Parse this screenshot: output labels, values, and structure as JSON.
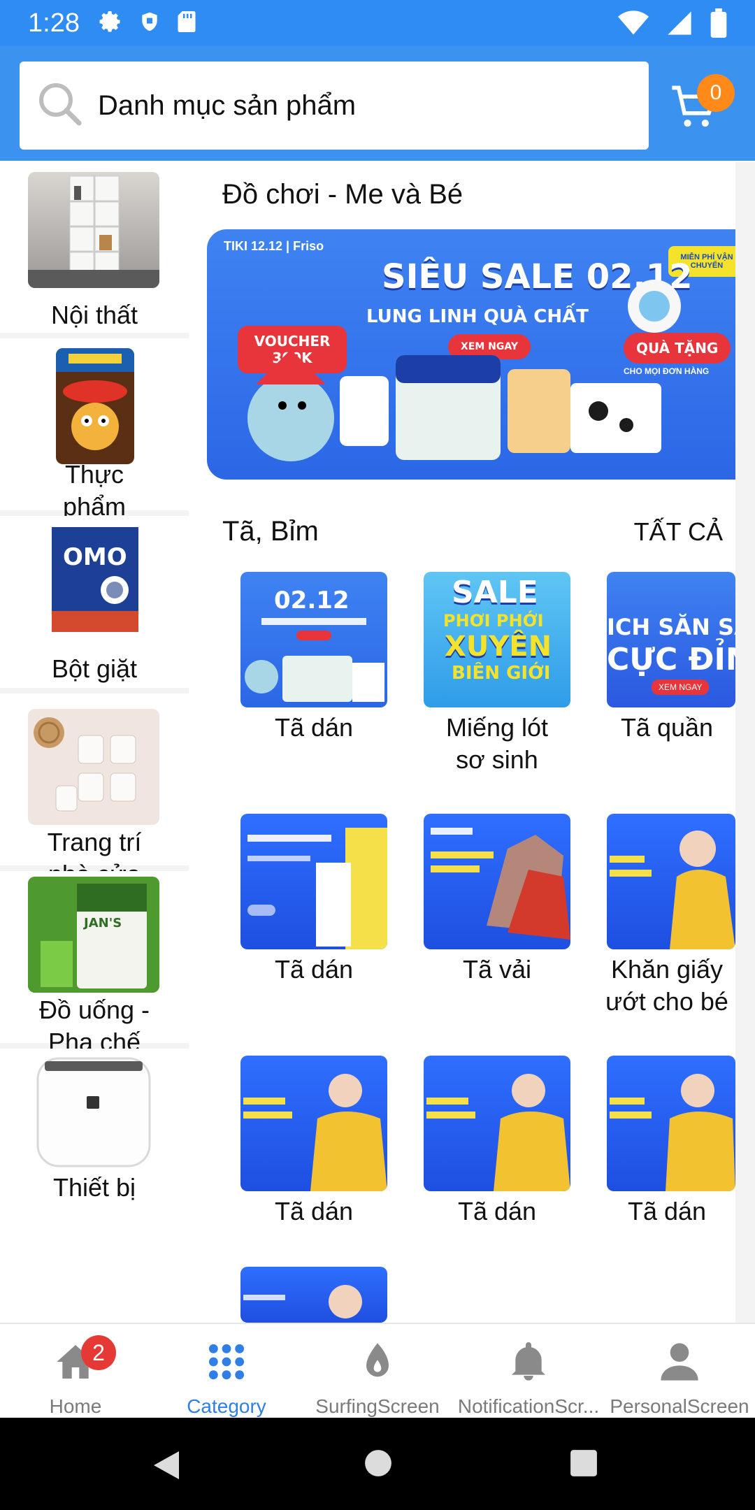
{
  "status_bar": {
    "time": "1:28"
  },
  "header": {
    "search_text": "Danh mục sản phẩm",
    "cart_count": "0"
  },
  "sidebar": {
    "items": [
      {
        "label_line1": "Nội thất",
        "label_line2": ""
      },
      {
        "label_line1": "Thực",
        "label_line2": "phẩm"
      },
      {
        "label_line1": "Bột giặt",
        "label_line2": ""
      },
      {
        "label_line1": "Trang trí",
        "label_line2": "nhà cửa"
      },
      {
        "label_line1": "Đồ uống -",
        "label_line2": "Pha chế"
      },
      {
        "label_line1": "Thiết bị",
        "label_line2": ""
      }
    ]
  },
  "main": {
    "section_title": "Đồ chơi - Me và Bé",
    "banner": {
      "brand": "TIKI 12.12 | Friso",
      "headline": "SIÊU SALE 02.12",
      "subheadline": "LUNG LINH QUÀ CHẤT",
      "cta": "XEM NGAY",
      "voucher": "VOUCHER 300K",
      "gift": "QUÀ TẶNG",
      "gift_sub": "CHO MỌI ĐƠN HÀNG",
      "shipping": "MIỄN PHÍ VẬN CHUYỂN"
    },
    "subsection_title": "Tã, Bỉm",
    "see_all": "TẤT CẢ",
    "products": [
      {
        "label_line1": "Tã dán",
        "label_line2": ""
      },
      {
        "label_line1": "Miếng lót",
        "label_line2": "sơ sinh"
      },
      {
        "label_line1": "Tã quần",
        "label_line2": ""
      },
      {
        "label_line1": "Tã dán",
        "label_line2": ""
      },
      {
        "label_line1": "Tã vải",
        "label_line2": ""
      },
      {
        "label_line1": "Khăn giấy",
        "label_line2": "ướt cho bé"
      },
      {
        "label_line1": "Tã dán",
        "label_line2": ""
      },
      {
        "label_line1": "Tã dán",
        "label_line2": ""
      },
      {
        "label_line1": "Tã dán",
        "label_line2": ""
      }
    ],
    "tile_texts": {
      "sale": "SALE",
      "phoi_phoi": "PHƠI PHỚI",
      "xuyen": "XUYÊN",
      "bien_gioi": "BIÊN GIỚI",
      "san_sale": "ICH SĂN SA",
      "cuc_dinh": "CỰC ĐỈN",
      "xem_ngay": "XEM NGAY"
    }
  },
  "bottom_nav": {
    "items": [
      {
        "label": "Home",
        "badge": "2"
      },
      {
        "label": "Category"
      },
      {
        "label": "SurfingScreen"
      },
      {
        "label": "NotificationScr..."
      },
      {
        "label": "PersonalScreen"
      }
    ]
  },
  "colors": {
    "primary_blue": "#3b92ef",
    "status_blue": "#2f8cf2",
    "active_nav": "#2f7fe7",
    "badge_orange": "#ff8a1a",
    "badge_red": "#e53935"
  }
}
